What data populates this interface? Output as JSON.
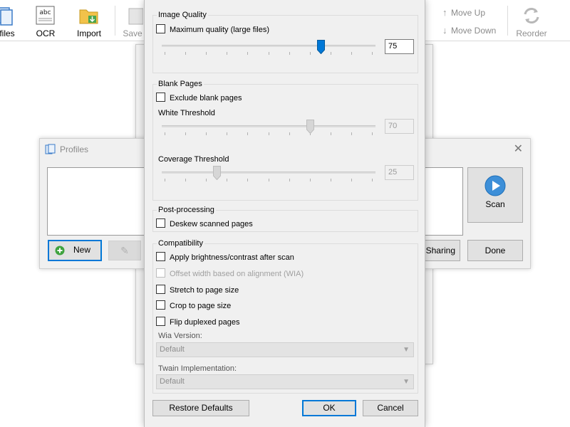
{
  "toolbar": {
    "profiles_label": "files",
    "ocr_label": "OCR",
    "ocr_icon_text": "abc",
    "import_label": "Import",
    "save_label": "Save",
    "move_up_label": "Move Up",
    "move_down_label": "Move Down",
    "reorder_label": "Reorder"
  },
  "profiles_window": {
    "title": "Profiles",
    "new_label": "New",
    "scan_label": "Scan",
    "sharing_label": "Sharing",
    "done_label": "Done"
  },
  "dialog": {
    "image_quality": {
      "group_label": "Image Quality",
      "max_quality_label": "Maximum quality (large files)",
      "max_quality_checked": false,
      "quality_value": "75",
      "quality_level": 75
    },
    "blank_pages": {
      "group_label": "Blank Pages",
      "exclude_label": "Exclude blank pages",
      "exclude_checked": false,
      "white_threshold_label": "White Threshold",
      "white_threshold_value": "70",
      "white_threshold_level": 70,
      "coverage_threshold_label": "Coverage Threshold",
      "coverage_threshold_value": "25",
      "coverage_threshold_level": 25
    },
    "post_processing": {
      "group_label": "Post-processing",
      "deskew_label": "Deskew scanned pages"
    },
    "compatibility": {
      "group_label": "Compatibility",
      "brightness_label": "Apply brightness/contrast after scan",
      "offset_width_label": "Offset width based on alignment (WIA)",
      "stretch_label": "Stretch to page size",
      "crop_label": "Crop to page size",
      "flip_label": "Flip duplexed pages",
      "wia_version_label": "Wia Version:",
      "wia_version_value": "Default",
      "twain_label": "Twain Implementation:",
      "twain_value": "Default"
    },
    "buttons": {
      "restore_defaults": "Restore Defaults",
      "ok": "OK",
      "cancel": "Cancel"
    }
  },
  "colors": {
    "accent": "#0078d7",
    "dialog_bg": "#f0f0f0",
    "disabled_text": "#a0a0a0"
  }
}
